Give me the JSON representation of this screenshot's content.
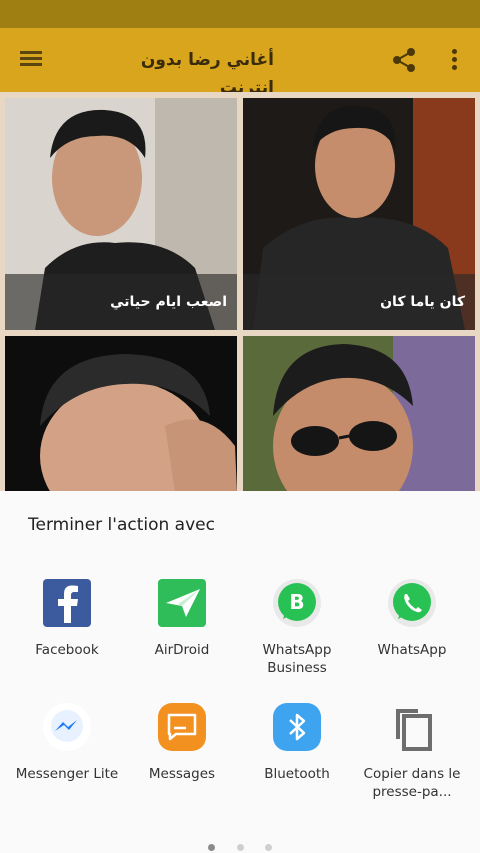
{
  "app_bar": {
    "title": "أغاني رضا بدون انترنت",
    "color": "#d9a51d",
    "menu_icon": "hamburger-menu-icon",
    "share_icon": "share-icon",
    "more_icon": "more-vert-icon"
  },
  "grid": {
    "cards": [
      {
        "caption": "اصعب ايام حياتي"
      },
      {
        "caption": "كان ياما كان"
      },
      {
        "caption": ""
      },
      {
        "caption": ""
      }
    ]
  },
  "share_sheet": {
    "title": "Terminer l'action avec",
    "apps": [
      {
        "label": "Facebook",
        "icon": "facebook-icon"
      },
      {
        "label": "AirDroid",
        "icon": "airdroid-icon"
      },
      {
        "label": "WhatsApp Business",
        "icon": "whatsapp-business-icon"
      },
      {
        "label": "WhatsApp",
        "icon": "whatsapp-icon"
      },
      {
        "label": "Messenger Lite",
        "icon": "messenger-lite-icon"
      },
      {
        "label": "Messages",
        "icon": "messages-icon"
      },
      {
        "label": "Bluetooth",
        "icon": "bluetooth-icon"
      },
      {
        "label": "Copier dans le presse-pa...",
        "icon": "copy-clipboard-icon"
      }
    ],
    "page_indicator": {
      "pages": 3,
      "current": 1
    }
  }
}
